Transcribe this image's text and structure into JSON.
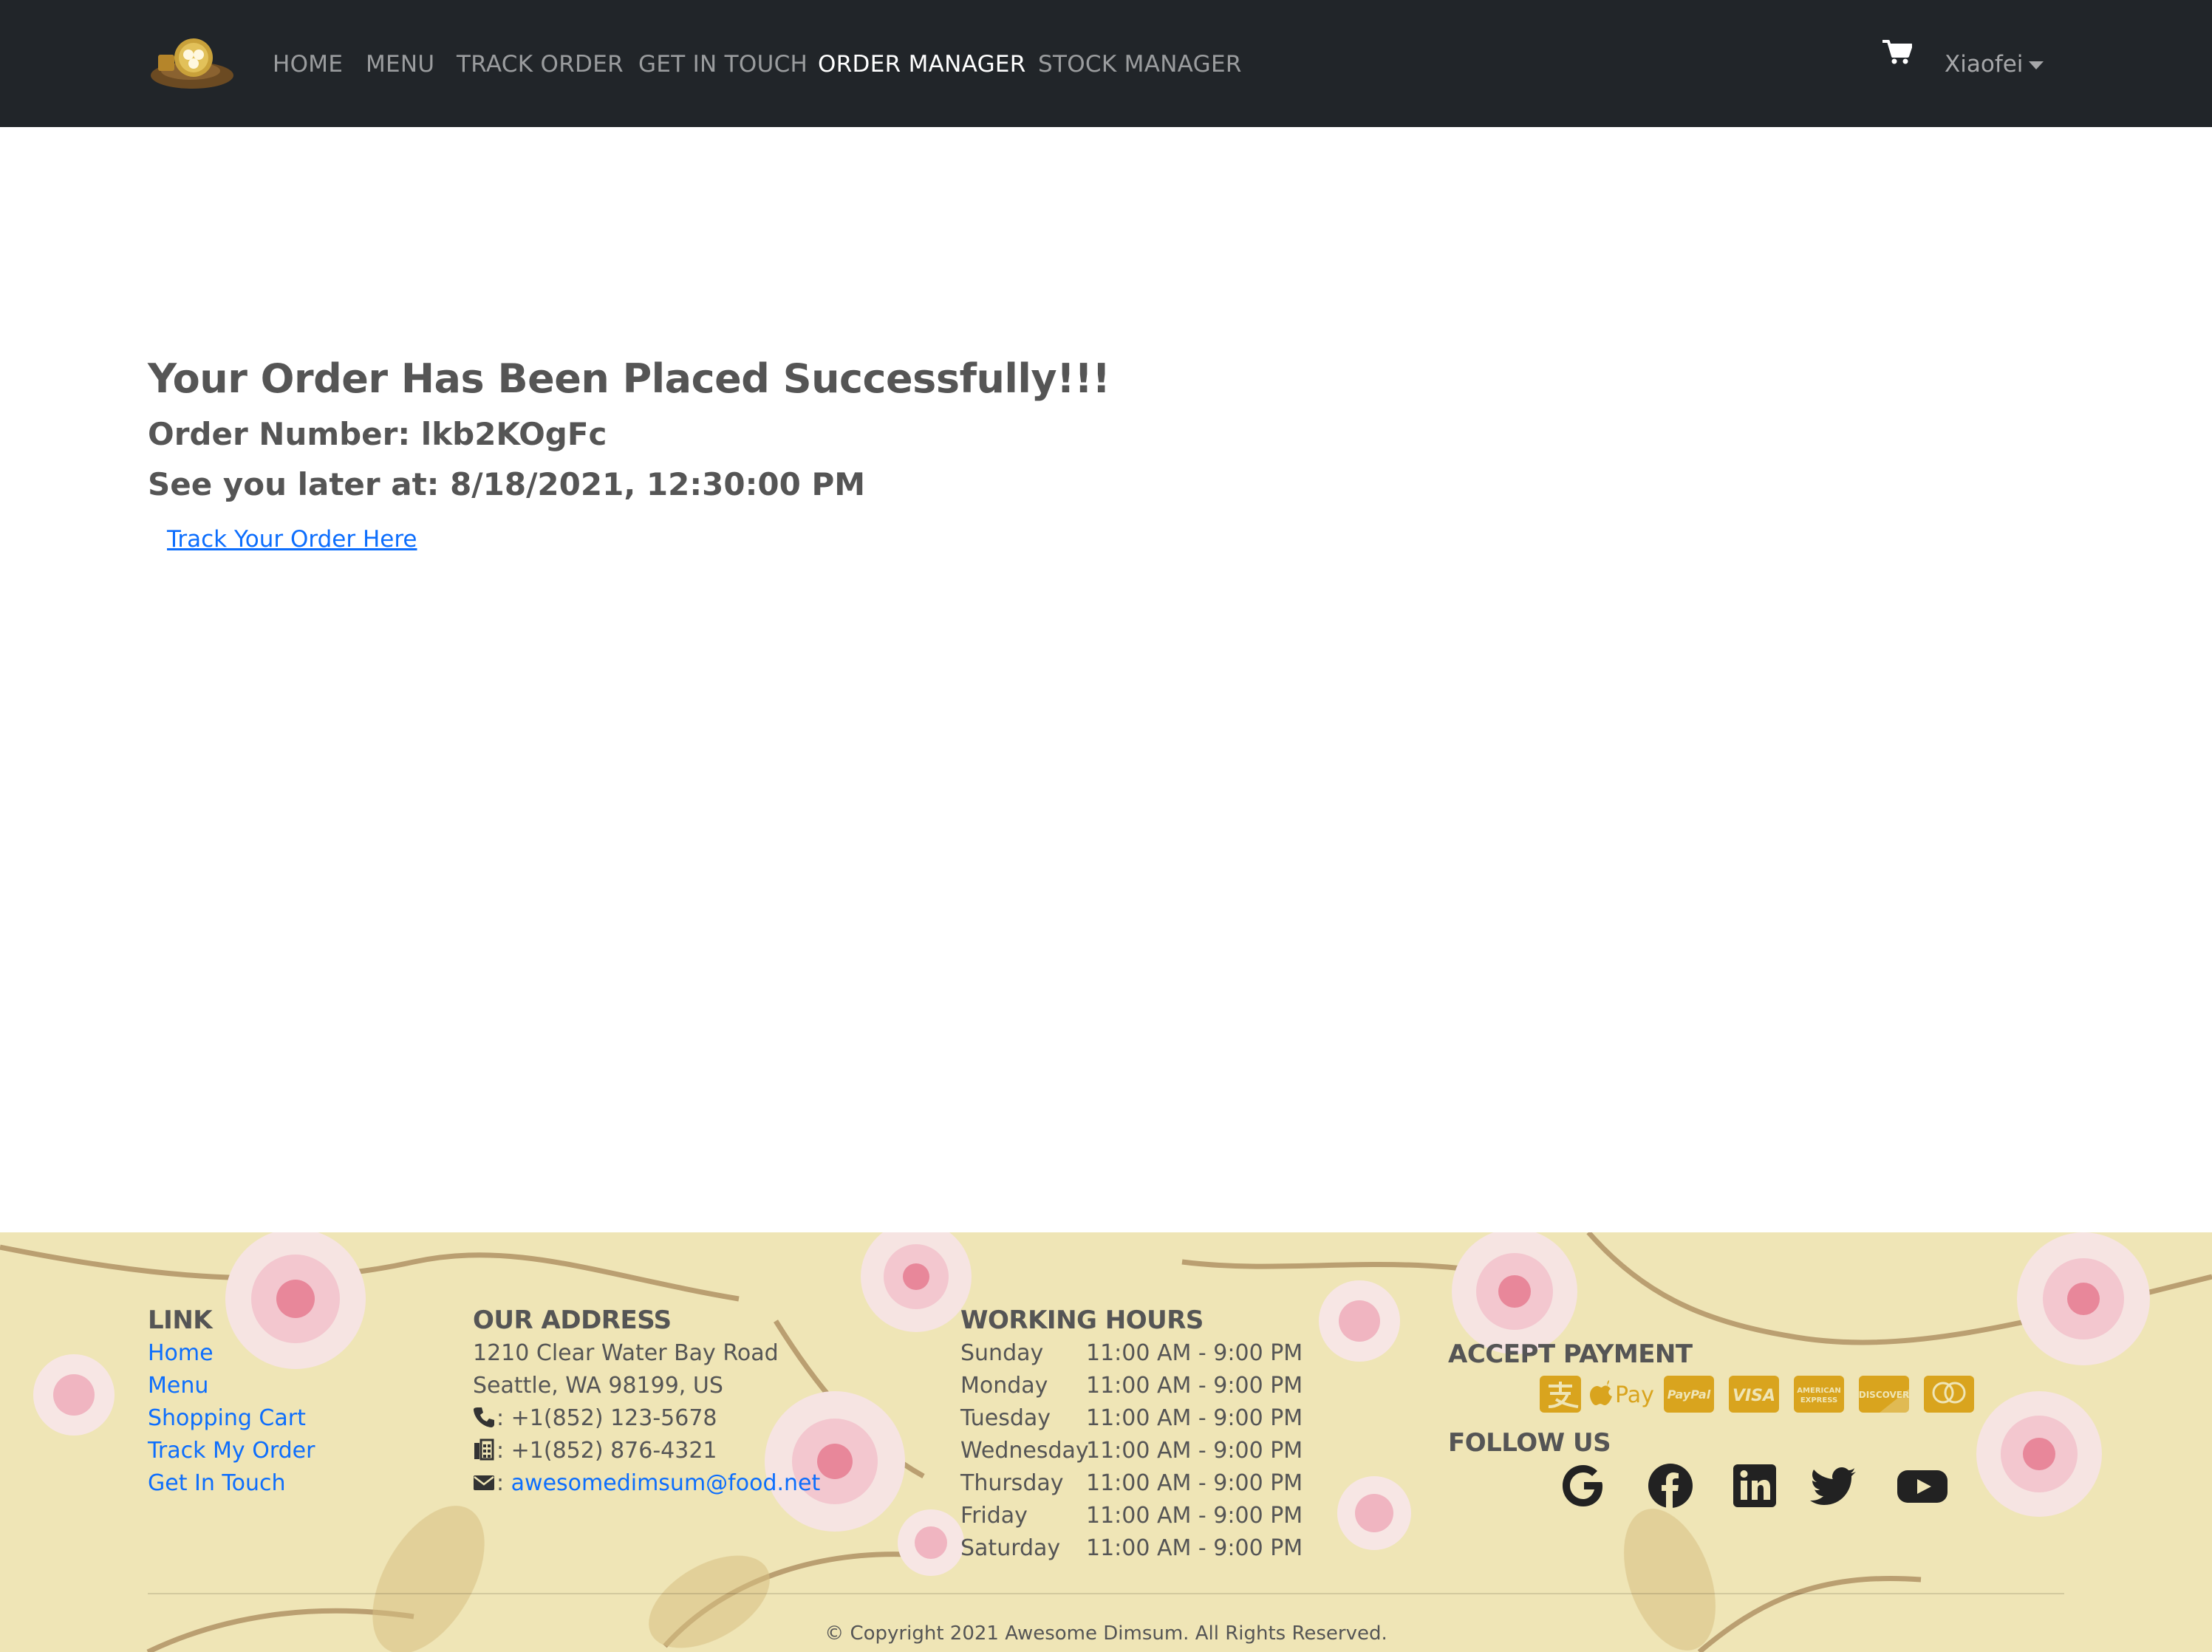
{
  "nav": {
    "logo": "logo",
    "items": [
      {
        "label": "HOME",
        "active": false
      },
      {
        "label": "MENU",
        "active": false
      },
      {
        "label": "TRACK ORDER",
        "active": false
      },
      {
        "label": "GET IN TOUCH",
        "active": false
      },
      {
        "label": "ORDER MANAGER",
        "active": true
      },
      {
        "label": "STOCK MANAGER",
        "active": false
      }
    ],
    "cart_icon": "shopping-cart-icon",
    "user": "Xiaofei"
  },
  "order": {
    "title": "Your Order Has Been Placed Successfully!!!",
    "number_label": "Order Number: lkb2KOgFc",
    "time_label": "See you later at: 8/18/2021, 12:30:00 PM",
    "track_link": "Track Your Order Here"
  },
  "footer": {
    "link": {
      "heading": "LINK",
      "items": [
        "Home",
        "Menu",
        "Shopping Cart",
        "Track My Order",
        "Get In Touch"
      ]
    },
    "address": {
      "heading": "OUR ADDRESS",
      "line1": "1210 Clear Water Bay Road",
      "line2": "Seattle, WA 98199, US",
      "phone": ": +1(852) 123-5678",
      "fax": ": +1(852) 876-4321",
      "email_prefix": ": ",
      "email": "awesomedimsum@food.net"
    },
    "hours": {
      "heading": "WORKING HOURS",
      "rows": [
        {
          "day": "Sunday",
          "time": "11:00 AM - 9:00 PM"
        },
        {
          "day": "Monday",
          "time": "11:00 AM - 9:00 PM"
        },
        {
          "day": "Tuesday",
          "time": "11:00 AM - 9:00 PM"
        },
        {
          "day": "Wednesday",
          "time": "11:00 AM - 9:00 PM"
        },
        {
          "day": "Thursday",
          "time": "11:00 AM - 9:00 PM"
        },
        {
          "day": "Friday",
          "time": "11:00 AM - 9:00 PM"
        },
        {
          "day": "Saturday",
          "time": "11:00 AM - 9:00 PM"
        }
      ]
    },
    "payment": {
      "heading": "ACCEPT PAYMENT",
      "icons": [
        "alipay-icon",
        "apple-pay-icon",
        "paypal-icon",
        "visa-icon",
        "american-express-icon",
        "discover-icon",
        "mastercard-icon"
      ],
      "accent": "#d9a41e"
    },
    "follow": {
      "heading": "FOLLOW US",
      "icons": [
        "google-icon",
        "facebook-icon",
        "linkedin-icon",
        "twitter-icon",
        "youtube-icon"
      ]
    },
    "copyright": "© Copyright 2021 Awesome Dimsum. All Rights Reserved."
  },
  "colors": {
    "navbar": "#212529",
    "link": "#0d6efd",
    "footer_bg": "#efe5b6",
    "text": "#555555"
  }
}
